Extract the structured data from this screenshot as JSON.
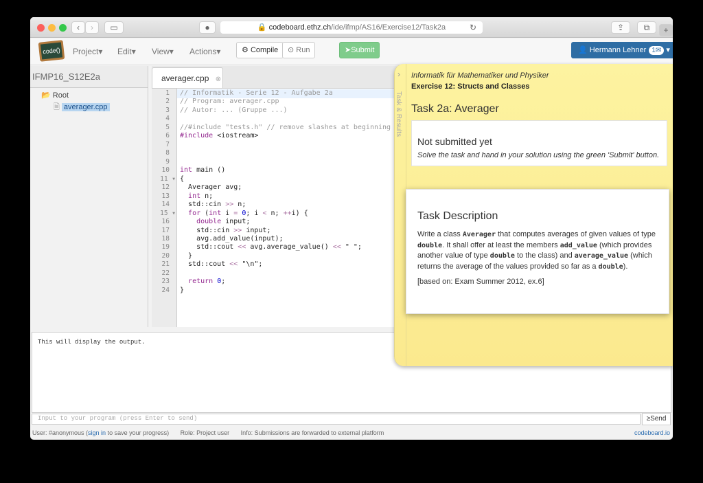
{
  "browser": {
    "url_domain": "codeboard.ethz.ch",
    "url_path": "/ide/ifmp/AS16/Exercise12/Task2a"
  },
  "navbar": {
    "logo": "code()",
    "menus": [
      "Project",
      "Edit",
      "View",
      "Actions"
    ],
    "compile": "Compile",
    "run": "Run",
    "submit": "Submit",
    "user": "Hermann Lehner",
    "badge": "1"
  },
  "sidebar": {
    "project": "IFMP16_S12E2a",
    "root": "Root",
    "file": "averager.cpp"
  },
  "editor": {
    "tab": "averager.cpp"
  },
  "output": {
    "text": "This will display the output.",
    "input_placeholder": "Input to your program (press Enter to send)",
    "send": "Send"
  },
  "status": {
    "user_prefix": "User: #anonymous (",
    "sign_in": "sign in",
    "user_suffix": " to save your progress)",
    "role": "Role: Project user",
    "info": "Info: Submissions are forwarded to external platform",
    "brand": "codeboard.io"
  },
  "task": {
    "side_label": "Task & Results",
    "course": "Informatik für Mathematiker und Physiker",
    "exercise": "Exercise 12: Structs and Classes",
    "title": "Task 2a: Averager",
    "status_title": "Not submitted yet",
    "status_text": "Solve the task and hand in your solution using the green 'Submit' button.",
    "desc_title": "Task Description",
    "d1": "Write a class ",
    "c1": "Averager",
    "d2": " that computes averages of given values of type ",
    "c2": "double",
    "d3": ". It shall offer at least the members ",
    "c3": "add_value",
    "d4": " (which provides another value of type ",
    "c4": "double",
    "d5": " to the class) and ",
    "c5": "average_value",
    "d6": " (which returns the average of the values provided so far as a ",
    "c6": "double",
    "d7": ").",
    "source": "[based on: Exam Summer 2012, ex.6]"
  }
}
